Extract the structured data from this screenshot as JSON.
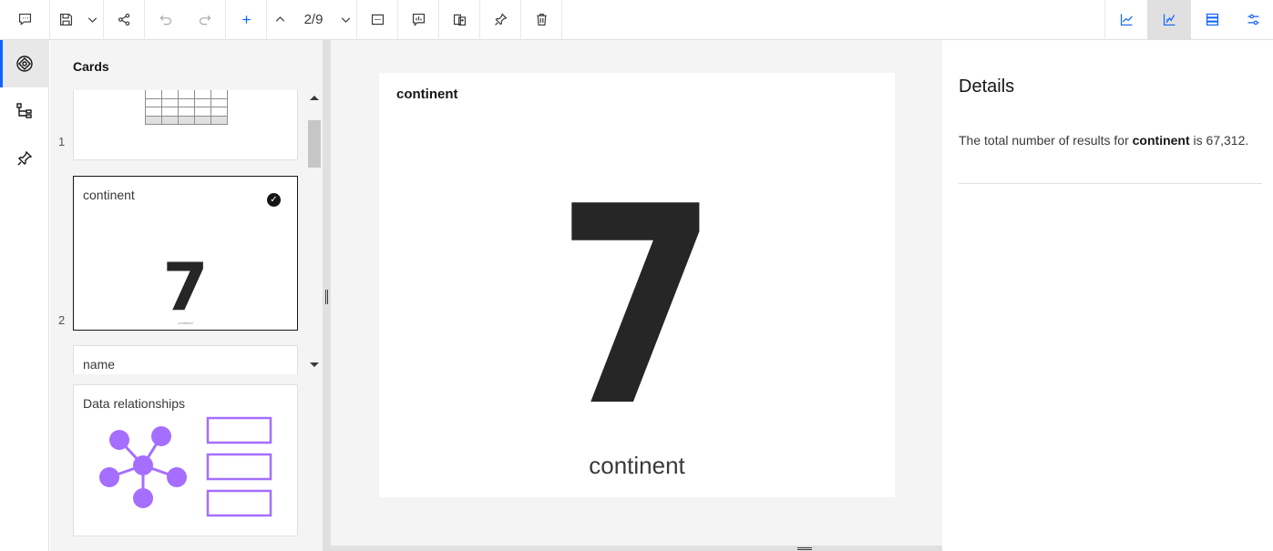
{
  "toolbar": {
    "page_indicator": "2/9"
  },
  "cards_panel": {
    "title": "Cards",
    "cards": [
      {
        "number": "1",
        "label": ""
      },
      {
        "number": "2",
        "label": "continent",
        "value": "7",
        "caption": "continent",
        "selected": true
      },
      {
        "number": "",
        "label": "name"
      }
    ],
    "relationships_card": {
      "title": "Data relationships"
    }
  },
  "main_card": {
    "title": "continent",
    "value": "7",
    "caption": "continent"
  },
  "details": {
    "title": "Details",
    "text_prefix": "The total number of results for ",
    "field": "continent",
    "text_mid": " is ",
    "count": "67,312",
    "text_suffix": "."
  },
  "colors": {
    "accent": "#0f62fe",
    "relationship_purple": "#a56eff"
  }
}
